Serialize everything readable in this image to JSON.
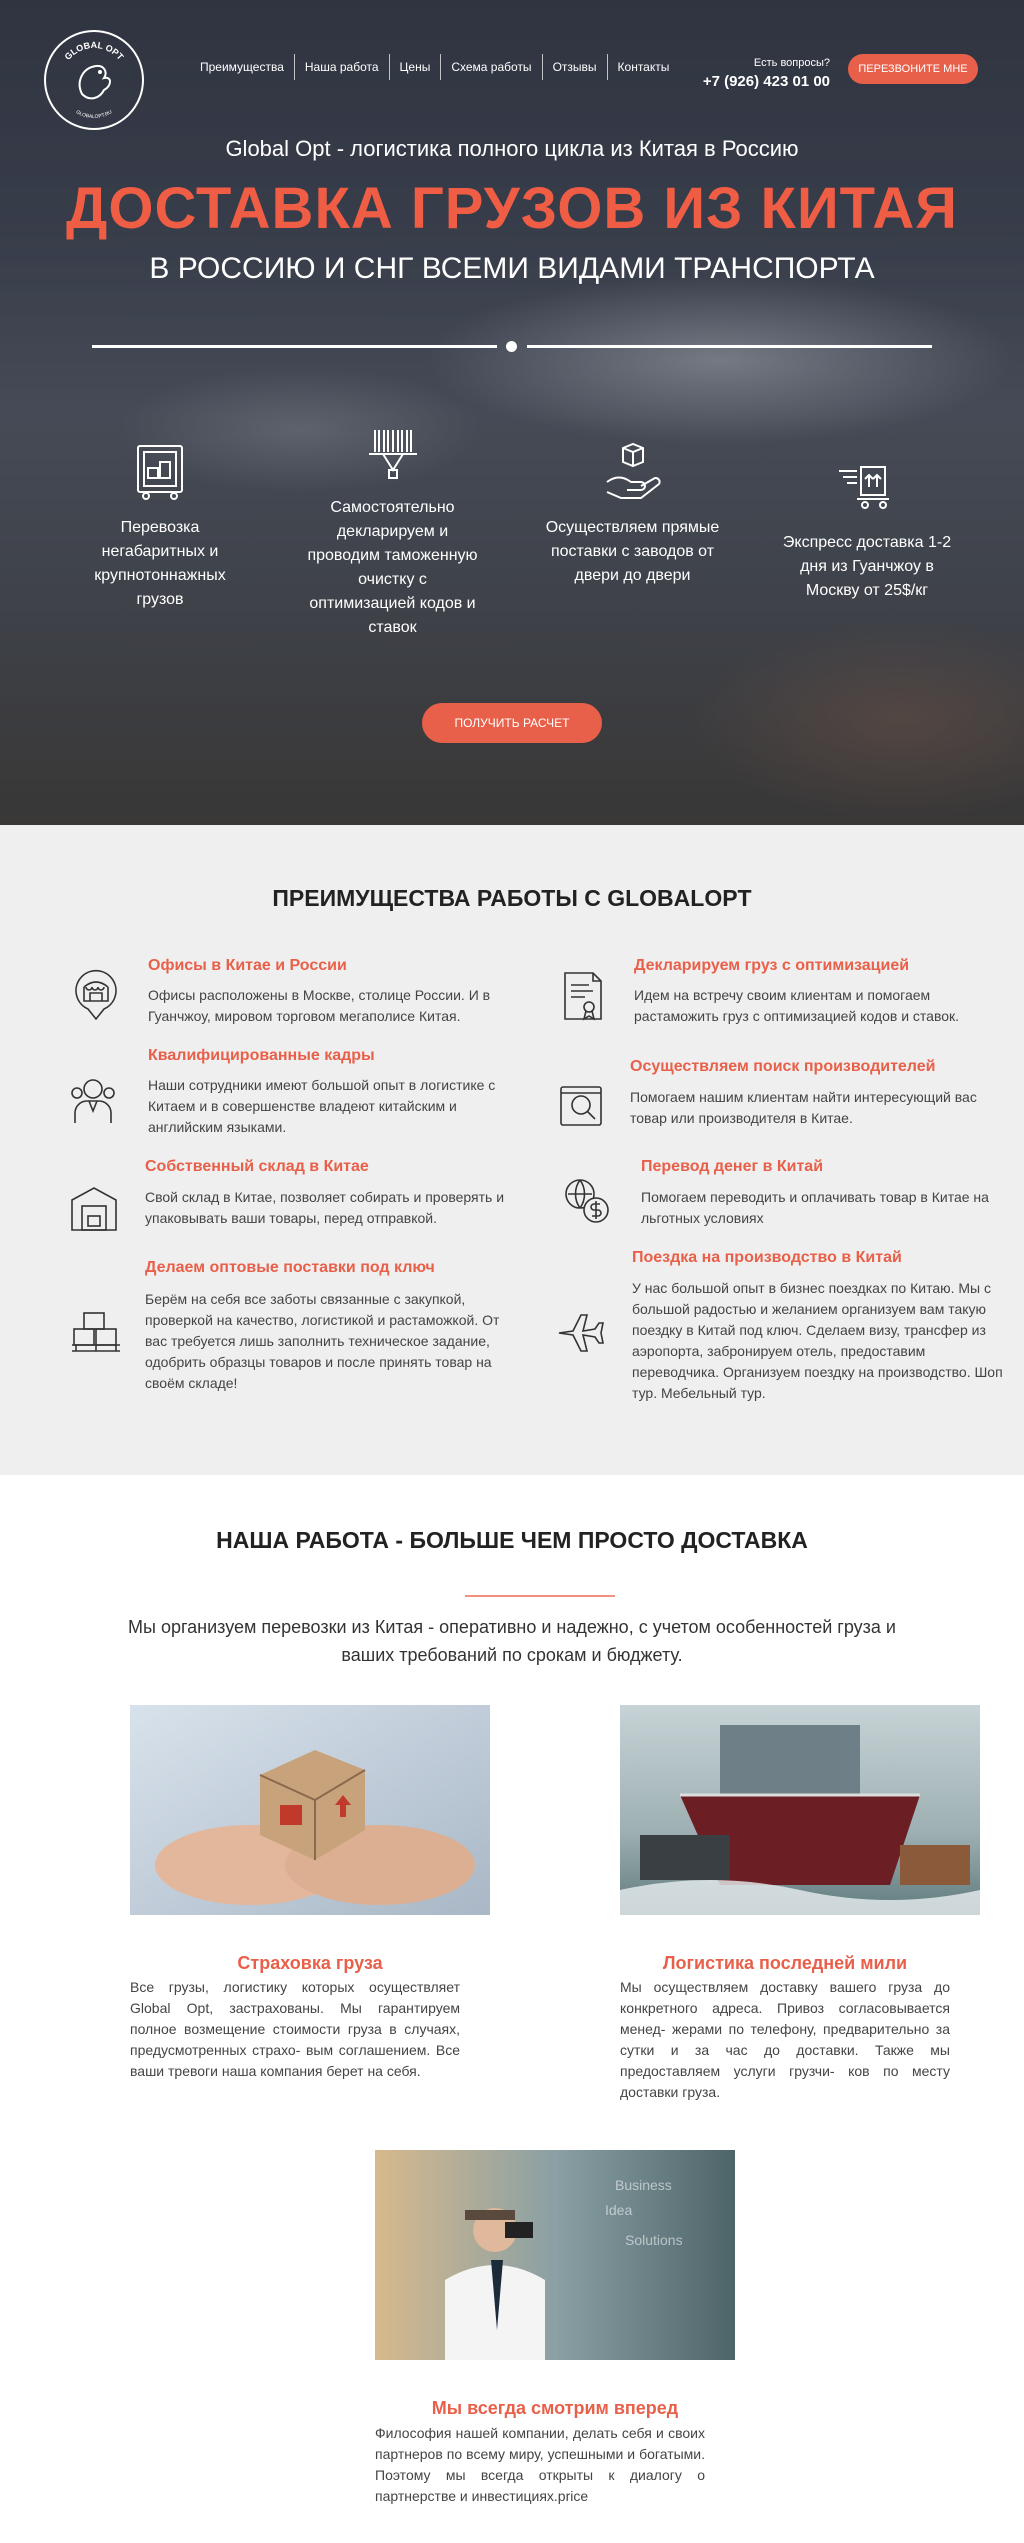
{
  "header": {
    "logo_text": "GLOBAL OPT",
    "logo_subtext": "GLOBALOPT.RU",
    "nav": [
      "Преимущества",
      "Наша работа",
      "Цены",
      "Схема работы",
      "Отзывы",
      "Контакты"
    ],
    "question": "Есть вопросы?",
    "phone": "+7 (926) 423 01 00",
    "callback_label": "ПЕРЕЗВОНИТЕ МНЕ"
  },
  "hero": {
    "subtitle": "Global Opt - логистика полного цикла из Китая в Россию",
    "title": "ДОСТАВКА ГРУЗОВ ИЗ КИТАЯ",
    "title2": "В РОССИЮ И СНГ ВСЕМИ ВИДАМИ ТРАНСПОРТА",
    "features": [
      {
        "icon": "cargo-icon",
        "text": "Перевозка негабаритных и крупнотоннажных грузов"
      },
      {
        "icon": "barcode-scanner-icon",
        "text": "Самостоятельно декларируем и проводим таможенную очистку с оптимизацией кодов и ставок"
      },
      {
        "icon": "box-hand-icon",
        "text": "Осуществляем прямые поставки с заводов от двери до двери"
      },
      {
        "icon": "fast-delivery-icon",
        "text": "Экспресс доставка 1-2 дня из Гуанчжоу в Москву от 25$/кг"
      }
    ],
    "cta_label": "ПОЛУЧИТЬ РАСЧЕТ"
  },
  "advantages": {
    "title": "ПРЕИМУЩЕСТВА РАБОТЫ С GLOBALOPT",
    "left": [
      {
        "icon": "market-location-icon",
        "heading": "Офисы в Китае и России",
        "text": "Офисы расположены в Москве, столице России. И в Гуанчжоу, мировом торговом мегаполисе Китая."
      },
      {
        "icon": "staff-icon",
        "heading": "Квалифицированные кадры",
        "text": "Наши сотрудники имеют большой опыт в логистике с Китаем и в совершенстве владеют китайским и английским языками."
      },
      {
        "icon": "warehouse-icon",
        "heading": "Собственный склад в Китае",
        "text": "Свой склад в Китае, позволяет собирать и проверять и упаковывать ваши товары, перед отправкой."
      },
      {
        "icon": "pallet-boxes-icon",
        "heading": "Делаем оптовые поставки под ключ",
        "text": "Берём на себя все заботы связанные с закупкой, проверкой на качество, логистикой и растаможкой. От вас требуется лишь заполнить техническое задание, одобрить образцы товаров и после принять товар на своём складе!"
      }
    ],
    "right": [
      {
        "icon": "certificate-icon",
        "heading": "Декларируем груз с оптимизацией",
        "text": "Идем на встречу своим клиентам и помогаем растаможить груз с оптимизацией кодов и ставок."
      },
      {
        "icon": "search-box-icon",
        "heading": "Осуществляем поиск производителей",
        "text": "Помогаем нашим клиентам найти интересующий вас товар или производителя в Китае."
      },
      {
        "icon": "money-transfer-icon",
        "heading": "Перевод денег в Китай",
        "text": "Помогаем переводить и оплачивать товар в Китае на льготных условиях"
      },
      {
        "icon": "airplane-icon",
        "heading": "Поездка на производство в Китай",
        "text": "У нас большой опыт в бизнес поездках по Китаю. Мы с большой радостью и желанием организуем вам такую поездку в Китай под ключ. Сделаем визу, трансфер из аэропорта, забронируем отель, предоставим переводчика. Организуем поездку на производство. Шоп тур. Мебельный тур."
      }
    ]
  },
  "work": {
    "title": "НАША РАБОТА - БОЛЬШЕ ЧЕМ ПРОСТО ДОСТАВКА",
    "lead": "Мы организуем перевозки из Китая - оперативно и надежно, с учетом особенностей груза и ваших требований по срокам и бюджету.",
    "cards": [
      {
        "heading": "Страховка груза",
        "text": "Все грузы, логистику которых осуществляет Global Opt, застрахованы. Мы гарантируем полное возмещение стоимости груза в случаях, предусмотренных страхо- вым соглашением. Все ваши тревоги наша компания берет на себя."
      },
      {
        "heading": "Логистика последней мили",
        "text": "Мы осуществляем доставку вашего груза до конкретного адреса. Привоз согласовывается менед- жерами по телефону, предварительно за сутки и за час до доставки. Также мы предоставляем услуги грузчи- ков по месту доставки груза."
      },
      {
        "heading": "Мы всегда смотрим вперед",
        "text": "Философия нашей компании, делать себя и своих партнеров по всему миру, успешными и богатыми. Поэтому мы всегда открыты к диалогу о партнерстве и инвестициях.price"
      }
    ],
    "photo3_words": [
      "Idea",
      "Business",
      "Solutions"
    ]
  },
  "colors": {
    "accent": "#e9604a",
    "adv_bg": "#efefef"
  }
}
